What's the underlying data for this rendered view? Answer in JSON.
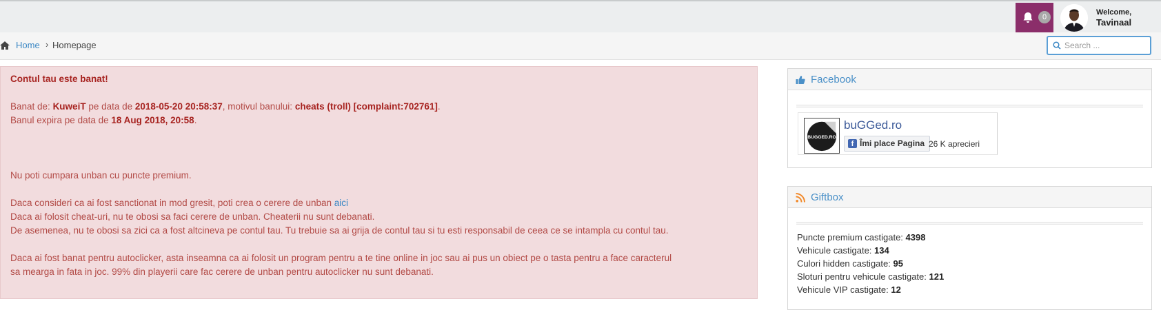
{
  "header": {
    "notifications_count": "0",
    "welcome_label": "Welcome,",
    "username": "Tavinaal"
  },
  "breadcrumb": {
    "home": "Home",
    "separator": "›",
    "current": "Homepage"
  },
  "search": {
    "placeholder": "Search ..."
  },
  "ban_alert": {
    "title": "Contul tau este banat!",
    "banned_by_prefix": "Banat de: ",
    "banned_by": "KuweiT",
    "date_prefix": " pe data de ",
    "date": "2018-05-20 20:58:37",
    "reason_prefix": ", motivul banului: ",
    "reason": "cheats (troll) [complaint:702761]",
    "reason_suffix": ".",
    "expires_prefix": "Banul expira pe data de ",
    "expires": "18 Aug 2018, 20:58",
    "expires_suffix": ".",
    "premium_note": "Nu poti cumpara unban cu puncte premium.",
    "appeal_text": "Daca consideri ca ai fost sanctionat in mod gresit, poti crea o cerere de unban ",
    "appeal_link": "aici",
    "cheats_note": "Daca ai folosit cheat-uri, nu te obosi sa faci cerere de unban. Cheaterii nu sunt debanati.",
    "account_note": "De asemenea, nu te obosi sa zici ca a fost altcineva pe contul tau. Tu trebuie sa ai grija de contul tau si tu esti responsabil de ceea ce se intampla cu contul tau.",
    "autoclicker_line1": "Daca ai fost banat pentru autoclicker, asta inseamna ca ai folosit un program pentru a te tine online in joc sau ai pus un obiect pe o tasta pentru a face caracterul",
    "autoclicker_line2": "sa mearga in fata in joc. 99% din playerii care fac cerere de unban pentru autoclicker nu sunt debanati."
  },
  "facebook_panel": {
    "title": "Facebook",
    "page_name": "buGGed.ro",
    "logo_text": "BUGGED.RO",
    "like_icon": "f",
    "like_button": "Îmi place Pagina",
    "likes": "26 K aprecieri"
  },
  "giftbox_panel": {
    "title": "Giftbox",
    "stats": [
      {
        "label": "Puncte premium castigate: ",
        "value": "4398"
      },
      {
        "label": "Vehicule castigate: ",
        "value": "134"
      },
      {
        "label": "Culori hidden castigate: ",
        "value": "95"
      },
      {
        "label": "Sloturi pentru vehicule castigate: ",
        "value": "121"
      },
      {
        "label": "Vehicule VIP castigate: ",
        "value": "12"
      }
    ]
  },
  "colors": {
    "notification_bg": "#8b2e6a",
    "alert_bg": "#f2dcde",
    "alert_text": "#b24a46",
    "link": "#3a87c4"
  },
  "icons": [
    "bell-icon",
    "home-icon",
    "search-icon",
    "thumbs-up-icon",
    "rss-icon",
    "facebook-icon"
  ]
}
